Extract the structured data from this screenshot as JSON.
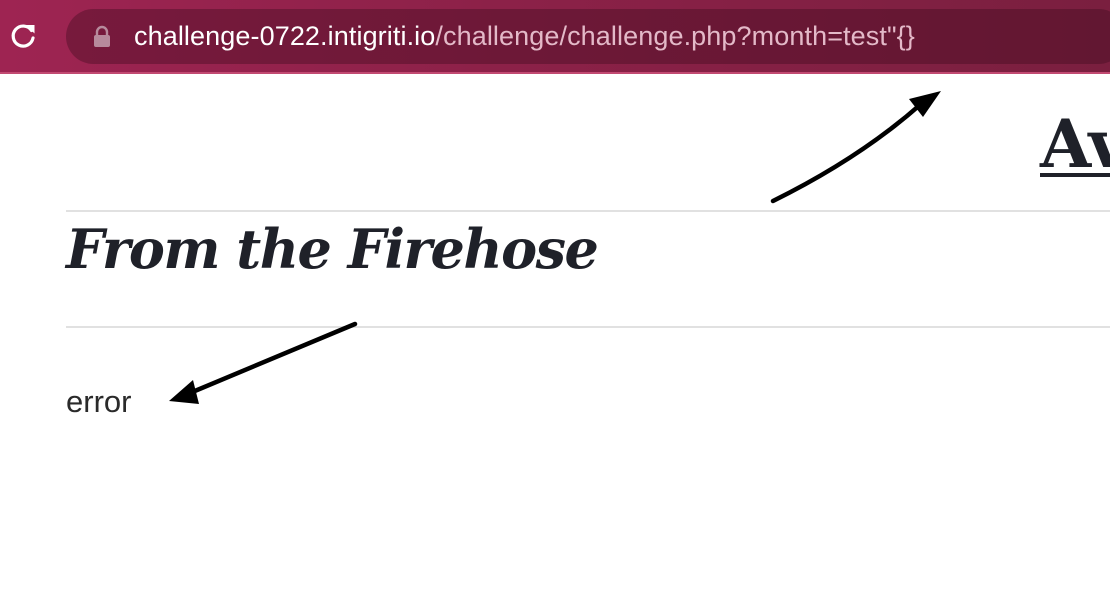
{
  "browser": {
    "url_host": "challenge-0722.intigriti.io",
    "url_path": "/challenge/challenge.php?month=test\"{}",
    "reload_icon": "reload-icon",
    "lock_icon": "lock-icon",
    "theme_color": "#9e2452"
  },
  "page": {
    "partial_heading": "Av",
    "section_title": "From the Firehose",
    "error_message": "error"
  },
  "annotations": {
    "arrow_color": "#000000",
    "arrow_icons": [
      "arrow-to-url",
      "arrow-to-error"
    ]
  }
}
